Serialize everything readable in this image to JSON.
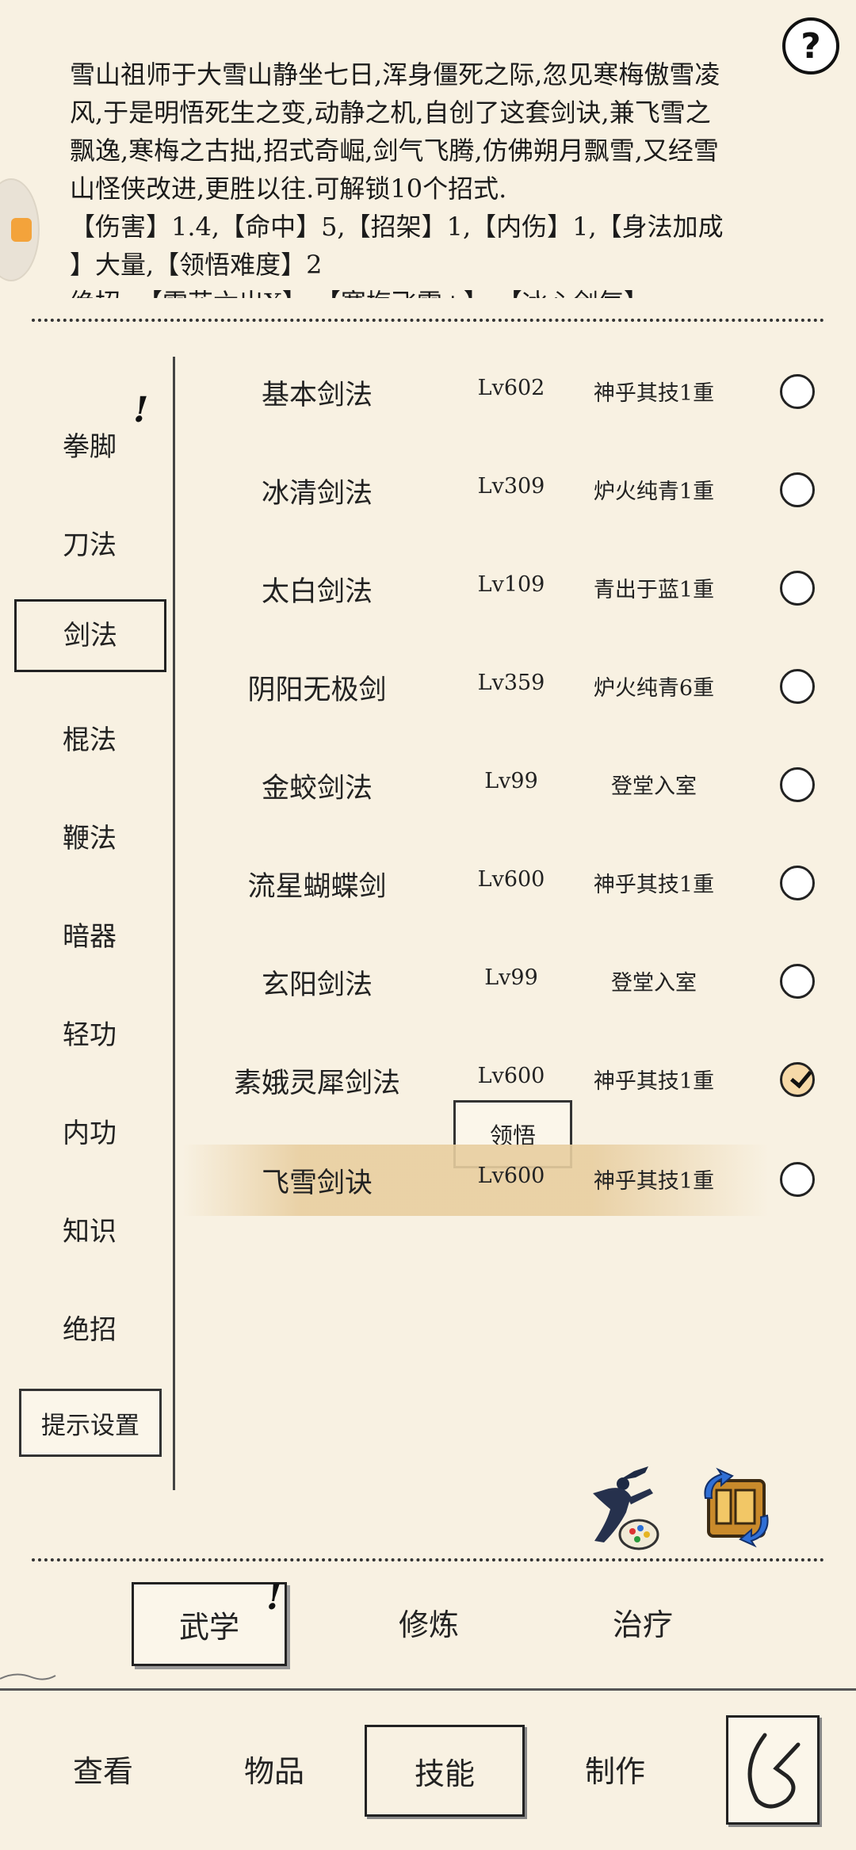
{
  "help_label": "?",
  "description": {
    "line1": "雪山祖师于大雪山静坐七日,浑身僵死之际,忽见寒梅傲雪凌",
    "line2": "风,于是明悟死生之变,动静之机,自创了这套剑诀,兼飞雪之",
    "line3": "飘逸,寒梅之古拙,招式奇崛,剑气飞腾,仿佛朔月飘雪,又经雪",
    "line4": "山怪侠改进,更胜以往.可解锁10个招式.",
    "line5": "【伤害】1.4,【命中】5,【招架】1,【内伤】1,【身法加成",
    "line6": "】大量,【领悟难度】2",
    "line7": "绝招: 【雪花六出X】,【寒梅飞雪+】,【冰心剑气】"
  },
  "categories": [
    "拳脚",
    "刀法",
    "剑法",
    "棍法",
    "鞭法",
    "暗器",
    "轻功",
    "内功",
    "知识",
    "绝招"
  ],
  "active_category": "剑法",
  "hint_settings_label": "提示设置",
  "skills": [
    {
      "name": "基本剑法",
      "level": "Lv602",
      "rank": "神乎其技1重",
      "checked": false
    },
    {
      "name": "冰清剑法",
      "level": "Lv309",
      "rank": "炉火纯青1重",
      "checked": false
    },
    {
      "name": "太白剑法",
      "level": "Lv109",
      "rank": "青出于蓝1重",
      "checked": false
    },
    {
      "name": "阴阳无极剑",
      "level": "Lv359",
      "rank": "炉火纯青6重",
      "checked": false
    },
    {
      "name": "金蛟剑法",
      "level": "Lv99",
      "rank": "登堂入室",
      "checked": false
    },
    {
      "name": "流星蝴蝶剑",
      "level": "Lv600",
      "rank": "神乎其技1重",
      "checked": false
    },
    {
      "name": "玄阳剑法",
      "level": "Lv99",
      "rank": "登堂入室",
      "checked": false
    },
    {
      "name": "素娥灵犀剑法",
      "level": "Lv600",
      "rank": "神乎其技1重",
      "checked": true
    },
    {
      "name": "飞雪剑诀",
      "level": "Lv600",
      "rank": "神乎其技1重",
      "checked": false
    }
  ],
  "comprehend_label": "领悟",
  "subtabs": [
    "武学",
    "修炼",
    "治疗"
  ],
  "bottom_tabs": [
    "查看",
    "物品",
    "技能",
    "制作"
  ],
  "exclaim": "!",
  "icons": {
    "help": "question-icon",
    "ninja": "martial-figure-icon",
    "scroll": "book-swap-icon",
    "back": "back-arrow-icon"
  }
}
